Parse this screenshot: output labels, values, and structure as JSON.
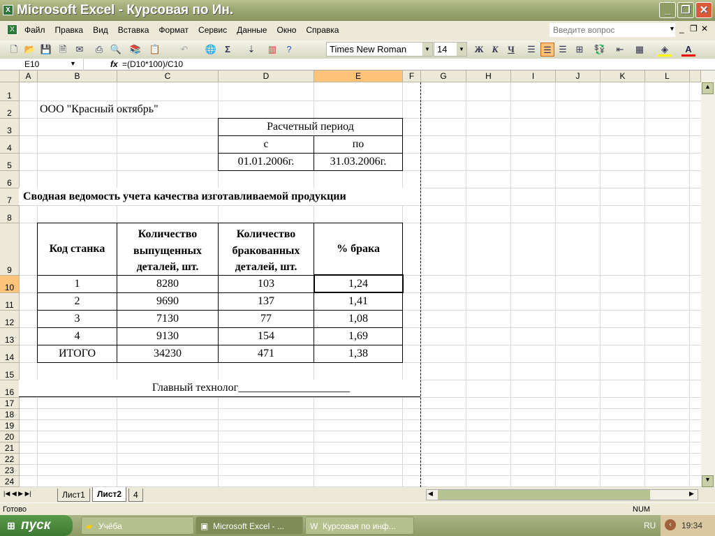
{
  "window": {
    "title": "Microsoft Excel - Курсовая по Ин."
  },
  "menu": [
    "Файл",
    "Правка",
    "Вид",
    "Вставка",
    "Формат",
    "Сервис",
    "Данные",
    "Окно",
    "Справка"
  ],
  "help_placeholder": "Введите вопрос",
  "toolbar": {
    "font": "Times New Roman",
    "size": "14",
    "bold": "Ж",
    "italic": "К",
    "underline": "Ч",
    "sum": "Σ"
  },
  "formula": {
    "cell": "E10",
    "fx": "fx",
    "value": "=(D10*100)/C10"
  },
  "columns": [
    "A",
    "B",
    "C",
    "D",
    "E",
    "F",
    "G",
    "H",
    "I",
    "J",
    "K",
    "L"
  ],
  "rows": [
    "1",
    "2",
    "3",
    "4",
    "5",
    "6",
    "7",
    "8",
    "9",
    "10",
    "11",
    "12",
    "13",
    "14",
    "15",
    "16",
    "17",
    "18",
    "19",
    "20",
    "21",
    "22",
    "23",
    "24"
  ],
  "cells": {
    "company": "ООО \"Красный октябрь\"",
    "period": "Расчетный период",
    "from": "с",
    "to": "по",
    "date_from": "01.01.2006г.",
    "date_to": "31.03.2006г.",
    "title": "Сводная ведомость учета качества изготавливаемой продукции",
    "headers": [
      "Код станка",
      "Количество\nвыпущенных\nдеталей, шт.",
      "Количество\nбракованных\nдеталей, шт.",
      "% брака"
    ],
    "data": [
      [
        "1",
        "8280",
        "103",
        "1,24"
      ],
      [
        "2",
        "9690",
        "137",
        "1,41"
      ],
      [
        "3",
        "7130",
        "77",
        "1,08"
      ],
      [
        "4",
        "9130",
        "154",
        "1,69"
      ],
      [
        "ИТОГО",
        "34230",
        "471",
        "1,38"
      ]
    ],
    "signature": "Главный технолог____________________"
  },
  "sheets": [
    "Лист1",
    "Лист2",
    "4"
  ],
  "status": {
    "ready": "Готово",
    "num": "NUM"
  },
  "taskbar": {
    "start": "пуск",
    "tasks": [
      "Учёба",
      "Microsoft Excel - ...",
      "Курсовая по инф..."
    ],
    "lang": "RU",
    "time": "19:34"
  }
}
